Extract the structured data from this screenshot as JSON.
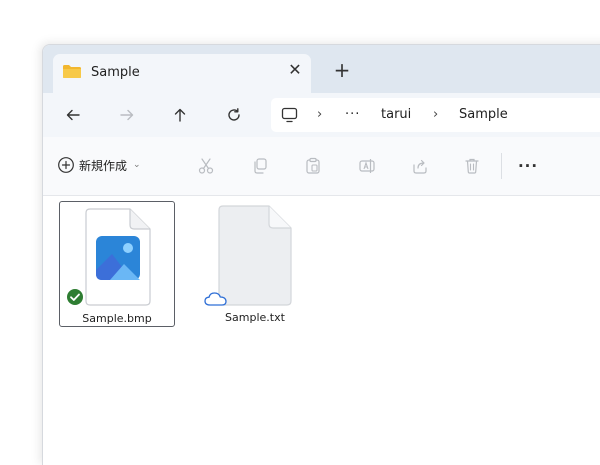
{
  "tab": {
    "title": "Sample",
    "folder_icon": "folder-icon",
    "close_glyph": "✕",
    "new_tab_glyph": "+"
  },
  "nav": {
    "back_icon": "arrow-left-icon",
    "forward_icon": "arrow-right-icon",
    "up_icon": "arrow-up-icon",
    "refresh_icon": "refresh-icon"
  },
  "address": {
    "pc_icon": "monitor-icon",
    "overflow": "···",
    "separator": "›",
    "items": [
      "tarui",
      "Sample"
    ]
  },
  "toolbar": {
    "new_label": "新規作成",
    "new_caret": "⌄",
    "more": "···",
    "tools": [
      "cut-icon",
      "copy-icon",
      "paste-icon",
      "rename-icon",
      "share-icon",
      "delete-icon"
    ]
  },
  "files": [
    {
      "name": "Sample.bmp",
      "selected": true,
      "status": "synced"
    },
    {
      "name": "Sample.txt",
      "selected": false,
      "status": "cloud"
    }
  ],
  "colors": {
    "accent": "#2e7d32",
    "folder": "#f2b72f",
    "cloud": "#2f6fd6",
    "image_icon": "#2b85d8"
  }
}
